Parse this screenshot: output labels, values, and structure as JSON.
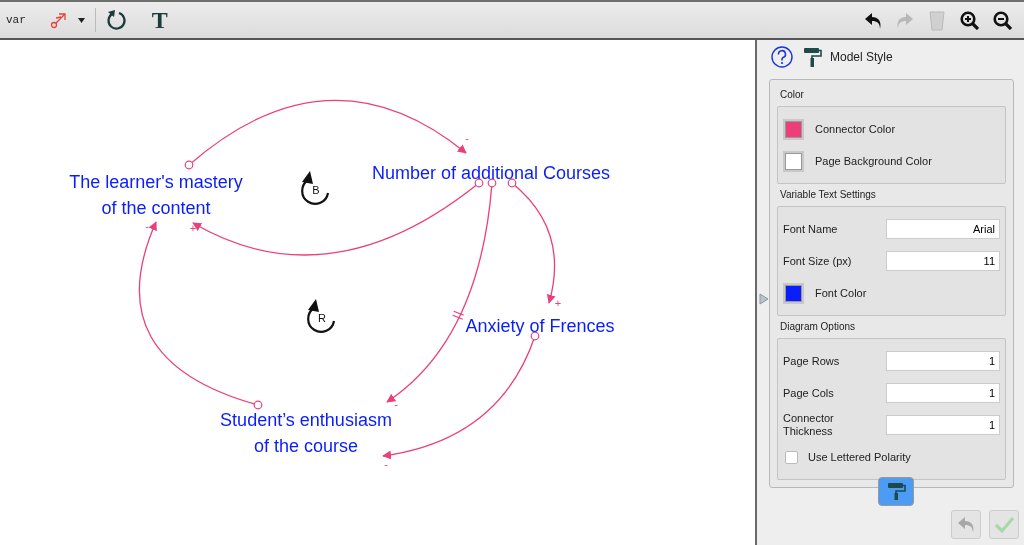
{
  "toolbar": {
    "variable_tool": "var",
    "text_tool": "T",
    "undo": {
      "disabled": false
    },
    "redo": {
      "disabled": true
    },
    "delete": {
      "disabled": true
    }
  },
  "diagram": {
    "variables": [
      {
        "label": "The learner's mastery\nof the content"
      },
      {
        "label": "Number of additional Courses"
      },
      {
        "label": "Anxiety of Frences"
      },
      {
        "label": "Student’s enthusiasm\nof the course"
      }
    ],
    "links": [
      {
        "polarity": "-",
        "delay": false
      },
      {
        "polarity": "+",
        "delay": false
      },
      {
        "polarity": "-",
        "delay": true
      },
      {
        "polarity": "+",
        "delay": false
      },
      {
        "polarity": "-",
        "delay": false
      },
      {
        "polarity": "-",
        "delay": false
      }
    ],
    "loops": [
      {
        "label": "B"
      },
      {
        "label": "R"
      }
    ]
  },
  "panel": {
    "title": "Model Style",
    "sections": [
      {
        "heading": "Color",
        "rows": [
          {
            "kind": "color",
            "label": "Connector Color",
            "color": "#ec3e78"
          },
          {
            "kind": "color",
            "label": "Page Background Color",
            "color": "#ffffff"
          }
        ]
      },
      {
        "heading": "Variable Text Settings",
        "rows": [
          {
            "kind": "text",
            "label": "Font Name",
            "value": "Arial"
          },
          {
            "kind": "text",
            "label": "Font Size (px)",
            "value": "11"
          },
          {
            "kind": "color",
            "label": "Font Color",
            "color": "#0a1efc"
          }
        ]
      },
      {
        "heading": "Diagram Options",
        "rows": [
          {
            "kind": "text",
            "label": "Page Rows",
            "value": "1"
          },
          {
            "kind": "text",
            "label": "Page Cols",
            "value": "1"
          },
          {
            "kind": "text",
            "label": "Connector\nThickness",
            "value": "1"
          },
          {
            "kind": "checkbox",
            "label": "Use Lettered Polarity",
            "checked": false
          }
        ]
      }
    ],
    "style_button": {
      "selected": true
    },
    "footer": {
      "undo": {
        "disabled": true
      },
      "ok": {
        "disabled": true
      }
    }
  }
}
